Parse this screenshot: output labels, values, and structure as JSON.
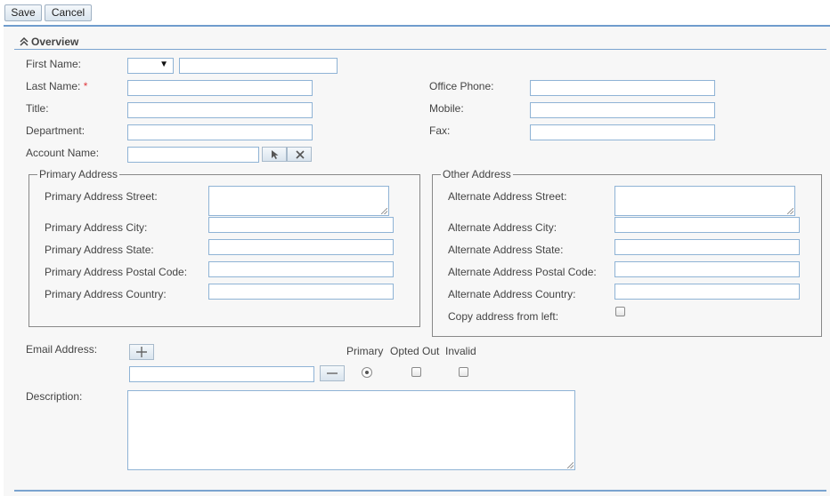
{
  "toolbar": {
    "save_label": "Save",
    "cancel_label": "Cancel"
  },
  "panel": {
    "title": "Overview",
    "collapse_icon": "double-chevron-up-icon"
  },
  "fields": {
    "first_name": {
      "label": "First Name:",
      "salutation_value": "",
      "value": ""
    },
    "last_name": {
      "label": "Last Name:",
      "required_mark": "*",
      "value": ""
    },
    "title": {
      "label": "Title:",
      "value": ""
    },
    "department": {
      "label": "Department:",
      "value": ""
    },
    "account_name": {
      "label": "Account Name:",
      "value": "",
      "select_icon": "arrow-cursor-icon",
      "clear_icon": "close-icon"
    },
    "office_phone": {
      "label": "Office Phone:",
      "value": ""
    },
    "mobile": {
      "label": "Mobile:",
      "value": ""
    },
    "fax": {
      "label": "Fax:",
      "value": ""
    }
  },
  "primary_address": {
    "legend": "Primary Address",
    "street_label": "Primary Address Street:",
    "city_label": "Primary Address City:",
    "state_label": "Primary Address State:",
    "postal_label": "Primary Address Postal Code:",
    "country_label": "Primary Address Country:"
  },
  "other_address": {
    "legend": "Other Address",
    "street_label": "Alternate Address Street:",
    "city_label": "Alternate Address City:",
    "state_label": "Alternate Address State:",
    "postal_label": "Alternate Address Postal Code:",
    "country_label": "Alternate Address Country:",
    "copy_label": "Copy address from left:",
    "copy_checked": false
  },
  "email": {
    "label": "Email Address:",
    "col_primary": "Primary",
    "col_opted_out": "Opted Out",
    "col_invalid": "Invalid",
    "value": "",
    "primary_selected": true,
    "opted_out": false,
    "invalid": false,
    "add_icon": "plus-icon",
    "remove_icon": "minus-icon"
  },
  "description": {
    "label": "Description:",
    "value": ""
  }
}
